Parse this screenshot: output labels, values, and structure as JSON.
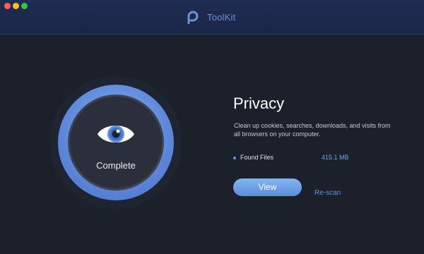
{
  "app": {
    "name": "ToolKit",
    "icon": "toolkit-logo-icon",
    "window_controls": [
      "close",
      "minimize",
      "zoom"
    ]
  },
  "scan_ring": {
    "icon": "eye-icon",
    "status": "Complete"
  },
  "category": {
    "title": "Privacy",
    "description": "Clean up cookies, searches, downloads, and visits from all browsers on your computer."
  },
  "results": {
    "found_label": "Found Files",
    "found_value": "415.1 MB"
  },
  "actions": {
    "view_label": "View",
    "rescan_label": "Re-scan"
  },
  "colors": {
    "accent": "#5c8fe0",
    "titlebar": "#1d2a4f",
    "background": "#1c202a"
  }
}
